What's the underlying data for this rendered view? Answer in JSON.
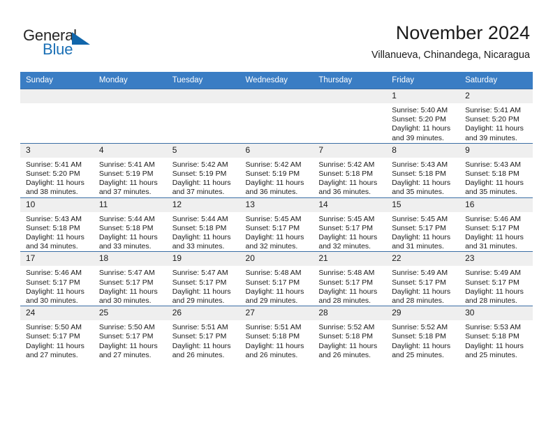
{
  "brand": {
    "name_part1": "General",
    "name_part2": "Blue"
  },
  "header": {
    "month_title": "November 2024",
    "location": "Villanueva, Chinandega, Nicaragua"
  },
  "colors": {
    "header_blue": "#3a7dc4",
    "grid_line": "#3a6ea5",
    "day_strip": "#efefef",
    "logo_blue": "#1166ab"
  },
  "weekdays": [
    "Sunday",
    "Monday",
    "Tuesday",
    "Wednesday",
    "Thursday",
    "Friday",
    "Saturday"
  ],
  "weeks": [
    [
      {
        "day": "",
        "empty": true
      },
      {
        "day": "",
        "empty": true
      },
      {
        "day": "",
        "empty": true
      },
      {
        "day": "",
        "empty": true
      },
      {
        "day": "",
        "empty": true
      },
      {
        "day": "1",
        "sunrise": "Sunrise: 5:40 AM",
        "sunset": "Sunset: 5:20 PM",
        "daylight": "Daylight: 11 hours and 39 minutes."
      },
      {
        "day": "2",
        "sunrise": "Sunrise: 5:41 AM",
        "sunset": "Sunset: 5:20 PM",
        "daylight": "Daylight: 11 hours and 39 minutes."
      }
    ],
    [
      {
        "day": "3",
        "sunrise": "Sunrise: 5:41 AM",
        "sunset": "Sunset: 5:20 PM",
        "daylight": "Daylight: 11 hours and 38 minutes."
      },
      {
        "day": "4",
        "sunrise": "Sunrise: 5:41 AM",
        "sunset": "Sunset: 5:19 PM",
        "daylight": "Daylight: 11 hours and 37 minutes."
      },
      {
        "day": "5",
        "sunrise": "Sunrise: 5:42 AM",
        "sunset": "Sunset: 5:19 PM",
        "daylight": "Daylight: 11 hours and 37 minutes."
      },
      {
        "day": "6",
        "sunrise": "Sunrise: 5:42 AM",
        "sunset": "Sunset: 5:19 PM",
        "daylight": "Daylight: 11 hours and 36 minutes."
      },
      {
        "day": "7",
        "sunrise": "Sunrise: 5:42 AM",
        "sunset": "Sunset: 5:18 PM",
        "daylight": "Daylight: 11 hours and 36 minutes."
      },
      {
        "day": "8",
        "sunrise": "Sunrise: 5:43 AM",
        "sunset": "Sunset: 5:18 PM",
        "daylight": "Daylight: 11 hours and 35 minutes."
      },
      {
        "day": "9",
        "sunrise": "Sunrise: 5:43 AM",
        "sunset": "Sunset: 5:18 PM",
        "daylight": "Daylight: 11 hours and 35 minutes."
      }
    ],
    [
      {
        "day": "10",
        "sunrise": "Sunrise: 5:43 AM",
        "sunset": "Sunset: 5:18 PM",
        "daylight": "Daylight: 11 hours and 34 minutes."
      },
      {
        "day": "11",
        "sunrise": "Sunrise: 5:44 AM",
        "sunset": "Sunset: 5:18 PM",
        "daylight": "Daylight: 11 hours and 33 minutes."
      },
      {
        "day": "12",
        "sunrise": "Sunrise: 5:44 AM",
        "sunset": "Sunset: 5:18 PM",
        "daylight": "Daylight: 11 hours and 33 minutes."
      },
      {
        "day": "13",
        "sunrise": "Sunrise: 5:45 AM",
        "sunset": "Sunset: 5:17 PM",
        "daylight": "Daylight: 11 hours and 32 minutes."
      },
      {
        "day": "14",
        "sunrise": "Sunrise: 5:45 AM",
        "sunset": "Sunset: 5:17 PM",
        "daylight": "Daylight: 11 hours and 32 minutes."
      },
      {
        "day": "15",
        "sunrise": "Sunrise: 5:45 AM",
        "sunset": "Sunset: 5:17 PM",
        "daylight": "Daylight: 11 hours and 31 minutes."
      },
      {
        "day": "16",
        "sunrise": "Sunrise: 5:46 AM",
        "sunset": "Sunset: 5:17 PM",
        "daylight": "Daylight: 11 hours and 31 minutes."
      }
    ],
    [
      {
        "day": "17",
        "sunrise": "Sunrise: 5:46 AM",
        "sunset": "Sunset: 5:17 PM",
        "daylight": "Daylight: 11 hours and 30 minutes."
      },
      {
        "day": "18",
        "sunrise": "Sunrise: 5:47 AM",
        "sunset": "Sunset: 5:17 PM",
        "daylight": "Daylight: 11 hours and 30 minutes."
      },
      {
        "day": "19",
        "sunrise": "Sunrise: 5:47 AM",
        "sunset": "Sunset: 5:17 PM",
        "daylight": "Daylight: 11 hours and 29 minutes."
      },
      {
        "day": "20",
        "sunrise": "Sunrise: 5:48 AM",
        "sunset": "Sunset: 5:17 PM",
        "daylight": "Daylight: 11 hours and 29 minutes."
      },
      {
        "day": "21",
        "sunrise": "Sunrise: 5:48 AM",
        "sunset": "Sunset: 5:17 PM",
        "daylight": "Daylight: 11 hours and 28 minutes."
      },
      {
        "day": "22",
        "sunrise": "Sunrise: 5:49 AM",
        "sunset": "Sunset: 5:17 PM",
        "daylight": "Daylight: 11 hours and 28 minutes."
      },
      {
        "day": "23",
        "sunrise": "Sunrise: 5:49 AM",
        "sunset": "Sunset: 5:17 PM",
        "daylight": "Daylight: 11 hours and 28 minutes."
      }
    ],
    [
      {
        "day": "24",
        "sunrise": "Sunrise: 5:50 AM",
        "sunset": "Sunset: 5:17 PM",
        "daylight": "Daylight: 11 hours and 27 minutes."
      },
      {
        "day": "25",
        "sunrise": "Sunrise: 5:50 AM",
        "sunset": "Sunset: 5:17 PM",
        "daylight": "Daylight: 11 hours and 27 minutes."
      },
      {
        "day": "26",
        "sunrise": "Sunrise: 5:51 AM",
        "sunset": "Sunset: 5:17 PM",
        "daylight": "Daylight: 11 hours and 26 minutes."
      },
      {
        "day": "27",
        "sunrise": "Sunrise: 5:51 AM",
        "sunset": "Sunset: 5:18 PM",
        "daylight": "Daylight: 11 hours and 26 minutes."
      },
      {
        "day": "28",
        "sunrise": "Sunrise: 5:52 AM",
        "sunset": "Sunset: 5:18 PM",
        "daylight": "Daylight: 11 hours and 26 minutes."
      },
      {
        "day": "29",
        "sunrise": "Sunrise: 5:52 AM",
        "sunset": "Sunset: 5:18 PM",
        "daylight": "Daylight: 11 hours and 25 minutes."
      },
      {
        "day": "30",
        "sunrise": "Sunrise: 5:53 AM",
        "sunset": "Sunset: 5:18 PM",
        "daylight": "Daylight: 11 hours and 25 minutes."
      }
    ]
  ]
}
